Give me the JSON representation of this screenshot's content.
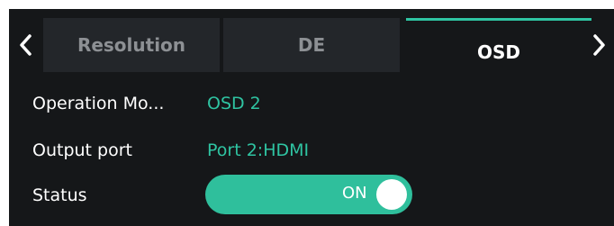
{
  "tabs": [
    {
      "label": "Resolution",
      "selected": false
    },
    {
      "label": "DE",
      "selected": false
    },
    {
      "label": "OSD",
      "selected": true
    }
  ],
  "nav": {
    "prev_icon": "chevron-left-icon",
    "next_icon": "chevron-right-icon"
  },
  "fields": {
    "operation_mode": {
      "label": "Operation Mo...",
      "value": "OSD 2"
    },
    "output_port": {
      "label": "Output port",
      "value": "Port 2:HDMI"
    },
    "status": {
      "label": "Status",
      "value": "ON",
      "enabled": true
    }
  },
  "colors": {
    "background": "#151719",
    "tab_inactive": "#23262a",
    "accent": "#2fc4a2",
    "text": "#ffffff",
    "text_muted": "#8d9094"
  }
}
